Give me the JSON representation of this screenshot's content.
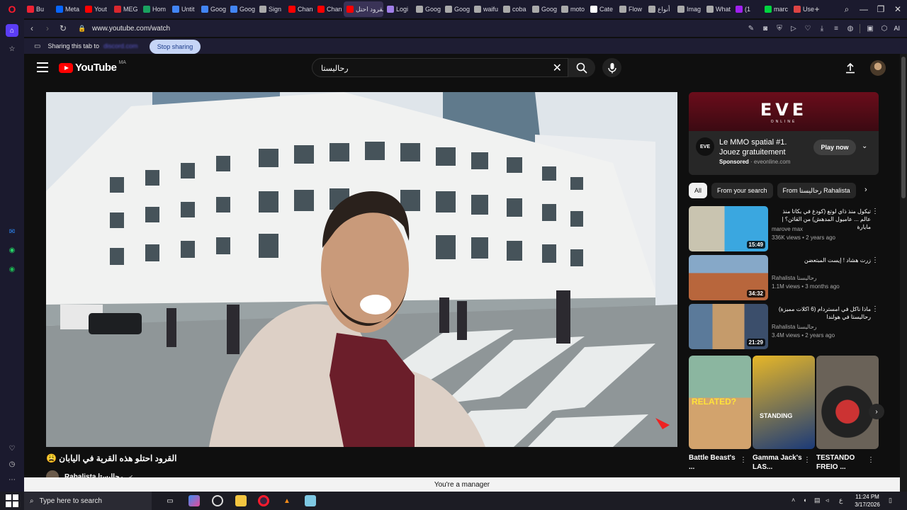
{
  "browser": {
    "tabs": [
      {
        "label": "Bu",
        "color": "#e23"
      },
      {
        "label": "Meta",
        "color": "#0866ff"
      },
      {
        "label": "Yout",
        "color": "#f00"
      },
      {
        "label": "MEG",
        "color": "#d9272e"
      },
      {
        "label": "Hom",
        "color": "#1aa260"
      },
      {
        "label": "Untit",
        "color": "#4285f4"
      },
      {
        "label": "Goog",
        "color": "#4285f4"
      },
      {
        "label": "Goog",
        "color": "#4285f4"
      },
      {
        "label": "Sign",
        "color": "#aaa"
      },
      {
        "label": "Chan",
        "color": "#f00"
      },
      {
        "label": "Chan",
        "color": "#f00"
      },
      {
        "label": "القرود احتل",
        "color": "#f00",
        "active": true
      },
      {
        "label": "Logi",
        "color": "#a07ee8"
      },
      {
        "label": "Goog",
        "color": "#aaa"
      },
      {
        "label": "Goog",
        "color": "#aaa"
      },
      {
        "label": "waifu",
        "color": "#aaa"
      },
      {
        "label": "coba",
        "color": "#aaa"
      },
      {
        "label": "Goog",
        "color": "#aaa"
      },
      {
        "label": "moto",
        "color": "#aaa"
      },
      {
        "label": "Cate",
        "color": "#fff"
      },
      {
        "label": "Flow",
        "color": "#aaa"
      },
      {
        "label": "أنواع",
        "color": "#aaa"
      },
      {
        "label": "Imag",
        "color": "#aaa"
      },
      {
        "label": "What",
        "color": "#aaa"
      },
      {
        "label": "(1",
        "color": "#a020f0"
      },
      {
        "label": "marc",
        "color": "#00d43f"
      },
      {
        "label": "Use",
        "color": "#d44"
      }
    ],
    "new_tab": "+",
    "url": "www.youtube.com/watch",
    "ai_label": "AI",
    "sharing_text": "Sharing this tab to",
    "sharing_target": "discord.com",
    "stop_sharing": "Stop sharing",
    "manager_text": "You're a manager"
  },
  "youtube": {
    "logo_text": "YouTube",
    "country_code": "MA",
    "search_value": "رحالیستا",
    "video_title": "القرود احتلو هذه القرية في اليابان 😩",
    "channel_name": "Rahalista رحالیستا",
    "ad": {
      "logo": "EVE",
      "logo_sub": "ONLINE",
      "icon_text": "EVE",
      "headline": "Le MMO spatial #1. Jouez gratuitement",
      "sponsored": "Sponsored",
      "domain": "eveonline.com",
      "play_label": "Play now"
    },
    "chips": [
      "All",
      "From your search",
      "From رحالیستا Rahalista"
    ],
    "recommendations": [
      {
        "title": "تيكول منذ ذاي لوتغ (كودغ في بكاتا منذ عالم ... عاميول المدهش) من القائن؟ | مايارة",
        "channel": "marove max",
        "meta": "336K views • 2 years ago",
        "duration": "15:49"
      },
      {
        "title": "زرت هشاد ! إيست المبتعضن",
        "channel": "Rahalista رحالیستا",
        "meta": "1.1M views • 3 months ago",
        "duration": "34:32"
      },
      {
        "title": "ماذا ناكل في امستردام (6 اكلات مميزة) رحالیستا في هولندا",
        "channel": "Rahalista رحالیستا",
        "meta": "3.4M views • 2 years ago",
        "duration": "21:29"
      }
    ],
    "shorts": [
      {
        "title": "Battle Beast's ...",
        "overlay": "RELATED?"
      },
      {
        "title": "Gamma Jack's LAS...",
        "overlay": "STANDING"
      },
      {
        "title": "TESTANDO FREIO ...",
        "overlay": ""
      }
    ]
  },
  "taskbar": {
    "search_placeholder": "Type here to search",
    "time": "11:24 PM",
    "date": "3/17/2026",
    "lang": "ع"
  }
}
